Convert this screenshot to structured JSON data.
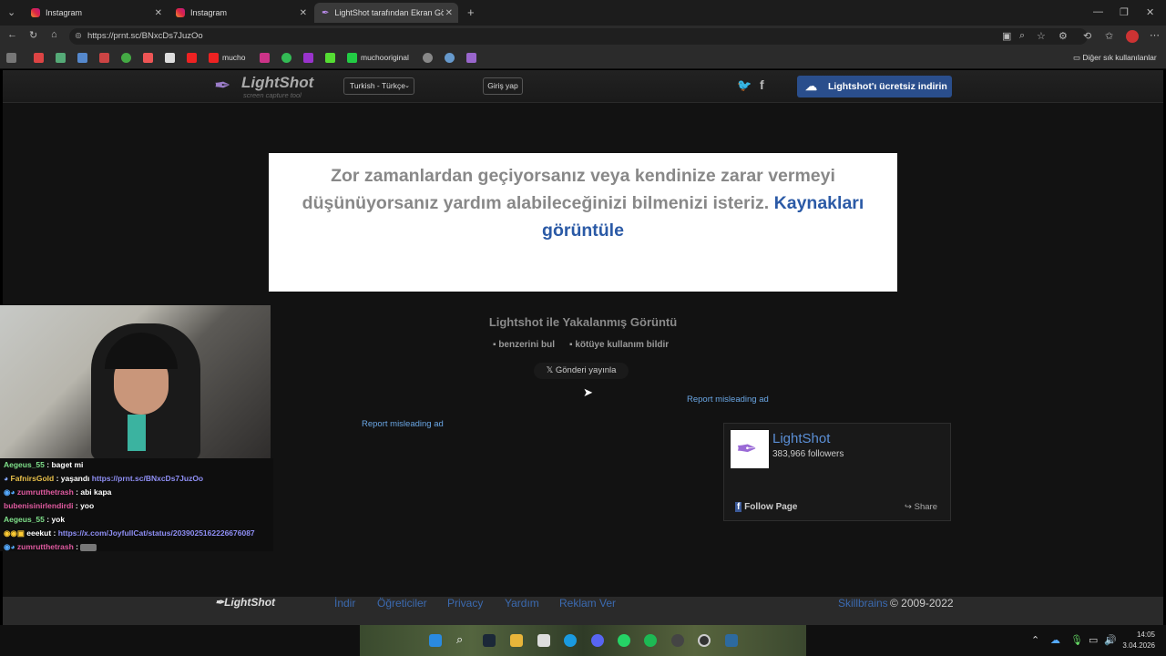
{
  "browser": {
    "tabs": [
      {
        "label": "Instagram"
      },
      {
        "label": "Instagram"
      },
      {
        "label": "LightShot tarafından Ekran Görüntü"
      }
    ],
    "url": "https://prnt.sc/BNxcDs7JuzOo",
    "bookmarks": [
      "mucho",
      "muchooriginal"
    ],
    "other_bookmarks": "Diğer sık kullanılanlar"
  },
  "lightshot": {
    "logo_title": "LightShot",
    "logo_subtitle": "screen capture tool",
    "language": "Turkish - Türkçe",
    "login": "Giriş yap",
    "download": "Lightshot'ı ücretsiz indirin",
    "warning_text": "Zor zamanlardan geçiyorsanız veya kendinize zarar vermeyi düşünüyorsanız yardım alabileceğinizi bilmenizi isteriz.",
    "warning_link": "Kaynakları görüntüle",
    "capture_title": "Lightshot ile Yakalanmış Görüntü",
    "find_similar": "benzerini bul",
    "report_abuse": "kötüye kullanım bildir",
    "tweet": "Gönderi yayınla",
    "report_ad_1": "Report misleading ad",
    "report_ad_2": "Report misleading ad",
    "fb": {
      "name": "LightShot",
      "followers": "383,966 followers",
      "follow": "Follow Page",
      "share": "Share"
    },
    "footer": {
      "logo": "LightShot",
      "links": [
        "İndir",
        "Öğreticiler",
        "Privacy",
        "Yardım",
        "Reklam Ver"
      ],
      "company": "Skillbrains",
      "copyright": "© 2009-2022"
    }
  },
  "chat": [
    {
      "user": "Aegeus_55",
      "color": "#7fe08a",
      "msg": "baget mi"
    },
    {
      "user": "FafnirsGold",
      "color": "#e8c04a",
      "msg": "yaşandı",
      "link": "https://prnt.sc/BNxcDs7JuzOo"
    },
    {
      "user": "zumrutthetrash",
      "color": "#e05aa0",
      "msg": "abi kapa"
    },
    {
      "user": "bubenisinirlendirdi",
      "color": "#e05aa0",
      "msg": "yoo"
    },
    {
      "user": "Aegeus_55",
      "color": "#7fe08a",
      "msg": "yok"
    },
    {
      "user": "eeekut",
      "color": "#ffffff",
      "msg": "",
      "link": "https://x.com/JoyfullCat/status/2039025162226676087"
    },
    {
      "user": "zumrutthetrash",
      "color": "#e05aa0",
      "msg": ""
    }
  ],
  "system": {
    "time": "14:05",
    "date": "3.04.2026"
  }
}
